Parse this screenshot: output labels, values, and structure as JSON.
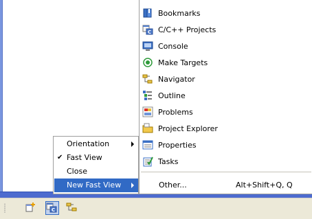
{
  "context_menu": {
    "items": [
      {
        "label": "Orientation",
        "checked": false,
        "submenu": true
      },
      {
        "label": "Fast View",
        "checked": true,
        "submenu": false
      },
      {
        "label": "Close",
        "checked": false,
        "submenu": false
      },
      {
        "label": "New Fast View",
        "checked": false,
        "submenu": true,
        "selected": true
      }
    ],
    "check_glyph": "✔"
  },
  "view_menu": {
    "items": [
      {
        "label": "Bookmarks",
        "icon": "bookmarks-icon"
      },
      {
        "label": "C/C++ Projects",
        "icon": "cpp-projects-icon"
      },
      {
        "label": "Console",
        "icon": "console-icon"
      },
      {
        "label": "Make Targets",
        "icon": "make-targets-icon"
      },
      {
        "label": "Navigator",
        "icon": "navigator-icon"
      },
      {
        "label": "Outline",
        "icon": "outline-icon"
      },
      {
        "label": "Problems",
        "icon": "problems-icon"
      },
      {
        "label": "Project Explorer",
        "icon": "project-explorer-icon"
      },
      {
        "label": "Properties",
        "icon": "properties-icon"
      },
      {
        "label": "Tasks",
        "icon": "tasks-icon"
      }
    ],
    "other": {
      "label": "Other...",
      "shortcut": "Alt+Shift+Q, Q"
    }
  },
  "fast_view_bar": {
    "icons": [
      "new-fast-view-icon",
      "cpp-projects-icon",
      "navigator-icon"
    ]
  },
  "colors": {
    "selection": "#316ac5",
    "bar_background": "#ece9d8",
    "title_blue": "#4d6bcf"
  }
}
